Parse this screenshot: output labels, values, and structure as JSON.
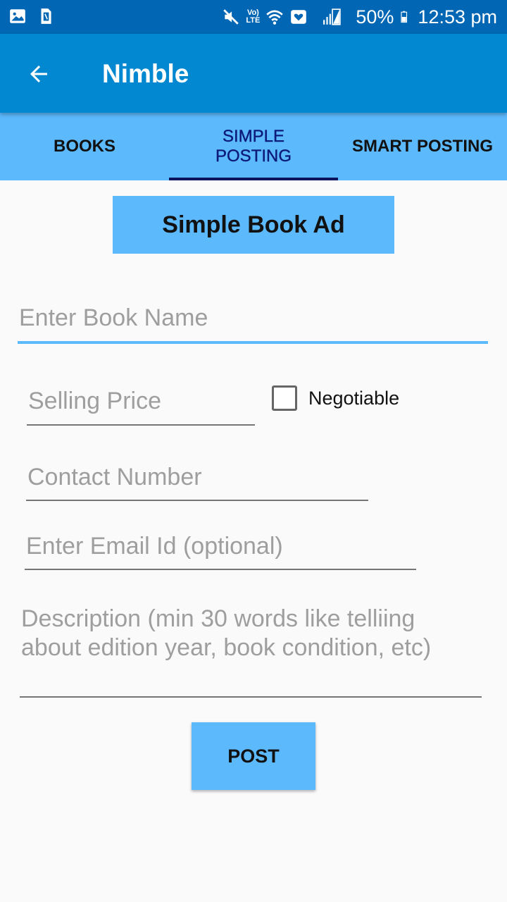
{
  "status_bar": {
    "lte_top": "Vo)",
    "lte_bottom": "LTE",
    "battery_percent": "50%",
    "time": "12:53 pm",
    "icons": [
      "image-icon",
      "sim-icon",
      "mute-icon",
      "wifi-icon",
      "heart-icon",
      "signal-icon",
      "battery-icon"
    ]
  },
  "app_bar": {
    "title": "Nimble",
    "back_icon": "arrow-left-icon"
  },
  "tabs": [
    {
      "label": "BOOKS",
      "active": false
    },
    {
      "label": "SIMPLE POSTING",
      "active": true
    },
    {
      "label": "SMART POSTING",
      "active": false
    }
  ],
  "form": {
    "header": "Simple Book Ad",
    "book_name_placeholder": "Enter Book Name",
    "selling_price_placeholder": "Selling Price",
    "negotiable_label": "Negotiable",
    "contact_placeholder": "Contact Number",
    "email_placeholder": "Enter Email Id (optional)",
    "description_placeholder": "Description (min 30 words like telliing about edition year, book condition, etc)",
    "post_label": "POST"
  },
  "colors": {
    "status_bar": "#0166b3",
    "app_bar": "#0288d1",
    "accent": "#5cb9fc",
    "tab_indicator": "#0b1560"
  }
}
